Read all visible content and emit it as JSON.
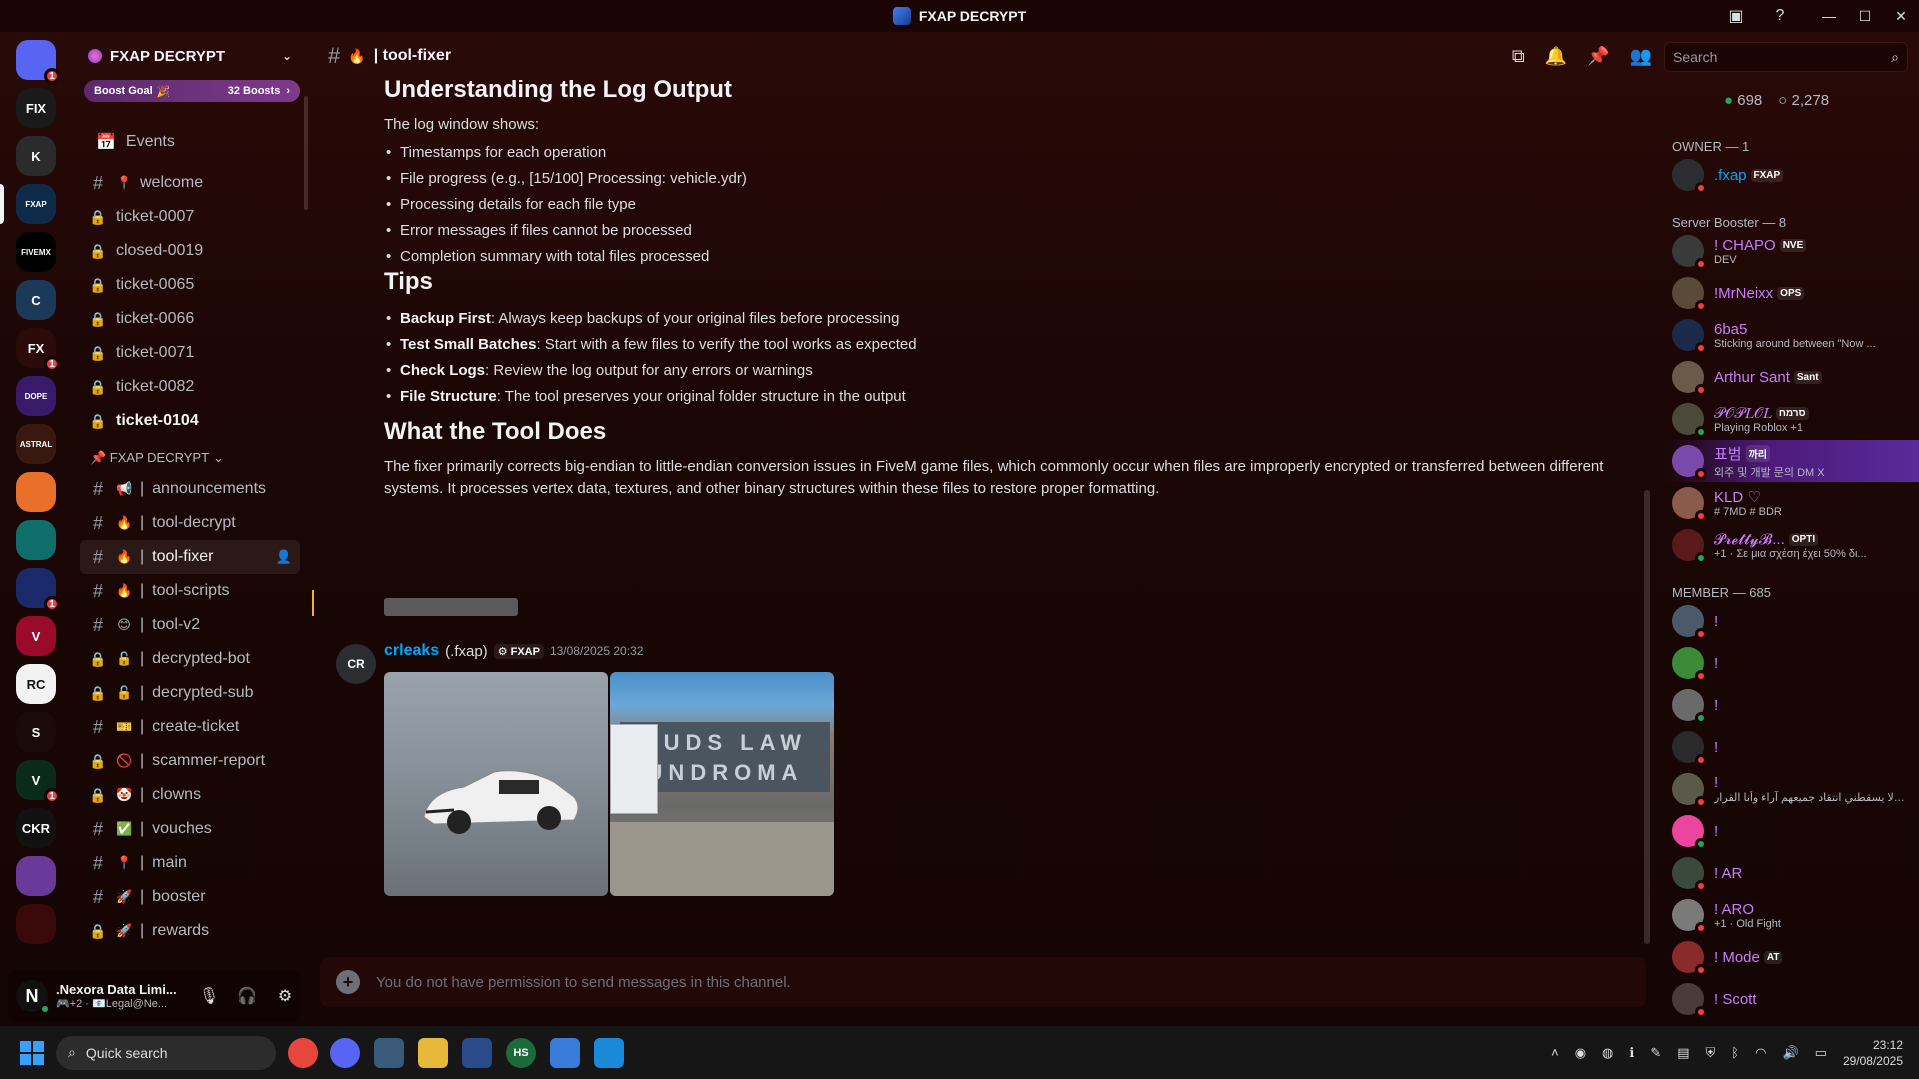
{
  "window": {
    "title": "FXAP DECRYPT"
  },
  "rail": {
    "servers": [
      {
        "name": "dm",
        "color": "#5865f2",
        "label": "",
        "badge": "1"
      },
      {
        "name": "fix-escrow",
        "color": "#1a1a1a",
        "label": "FIX",
        "badge": ""
      },
      {
        "name": "kings",
        "color": "#2b2b2b",
        "label": "K",
        "badge": ""
      },
      {
        "name": "fxap-decrypt",
        "color": "#0f2b4a",
        "label": "FXAP",
        "badge": ""
      },
      {
        "name": "fivemx",
        "color": "#000000",
        "label": "FIVEMX",
        "badge": ""
      },
      {
        "name": "c-server",
        "color": "#1b3a5a",
        "label": "C",
        "badge": ""
      },
      {
        "name": "fx-server",
        "color": "#2b0a0a",
        "label": "FX",
        "badge": "1"
      },
      {
        "name": "dope",
        "color": "#3a1a6a",
        "label": "DOPE",
        "badge": ""
      },
      {
        "name": "astral-leaks",
        "color": "#3a1a10",
        "label": "ASTRAL",
        "badge": ""
      },
      {
        "name": "stripes",
        "color": "#e8702a",
        "label": "",
        "badge": ""
      },
      {
        "name": "clock-server",
        "color": "#0f6e6a",
        "label": "",
        "badge": ""
      },
      {
        "name": "star-server",
        "color": "#1a2a6a",
        "label": "",
        "badge": "1"
      },
      {
        "name": "v-server",
        "color": "#9a0a2a",
        "label": "V",
        "badge": ""
      },
      {
        "name": "rc-server",
        "color": "#f2f2f2",
        "label": "RC",
        "badge": ""
      },
      {
        "name": "s-server",
        "color": "#1a0a0a",
        "label": "S",
        "badge": ""
      },
      {
        "name": "vy-server",
        "color": "#0a2a1a",
        "label": "V",
        "badge": "1"
      },
      {
        "name": "ckr",
        "color": "#111111",
        "label": "CKR",
        "badge": ""
      },
      {
        "name": "pride",
        "color": "#6a3a9a",
        "label": "",
        "badge": ""
      },
      {
        "name": "red-char",
        "color": "#3a0a0a",
        "label": "",
        "badge": ""
      }
    ]
  },
  "sidebar": {
    "guild_name": "FXAP DECRYPT",
    "boost_label": "Boost Goal",
    "boost_count": "32 Boosts",
    "events_label": "Events",
    "channels_top": [
      {
        "icon": "hash",
        "emoji": "📍",
        "label": "welcome",
        "bold": false
      },
      {
        "icon": "lock",
        "emoji": "",
        "label": "ticket-0007",
        "bold": false
      },
      {
        "icon": "lock",
        "emoji": "",
        "label": "closed-0019",
        "bold": false
      },
      {
        "icon": "lock",
        "emoji": "",
        "label": "ticket-0065",
        "bold": false
      },
      {
        "icon": "lock",
        "emoji": "",
        "label": "ticket-0066",
        "bold": false
      },
      {
        "icon": "lock",
        "emoji": "",
        "label": "ticket-0071",
        "bold": false
      },
      {
        "icon": "lock",
        "emoji": "",
        "label": "ticket-0082",
        "bold": false
      },
      {
        "icon": "lock",
        "emoji": "",
        "label": "ticket-0104",
        "bold": true
      }
    ],
    "category": "📌 FXAP DECRYPT",
    "channels": [
      {
        "icon": "hash",
        "emoji": "📢",
        "label": "announcements"
      },
      {
        "icon": "hash",
        "emoji": "🔥",
        "label": "tool-decrypt"
      },
      {
        "icon": "hash",
        "emoji": "🔥",
        "label": "tool-fixer",
        "active": true
      },
      {
        "icon": "hash",
        "emoji": "🔥",
        "label": "tool-scripts"
      },
      {
        "icon": "hash",
        "emoji": "😊",
        "label": "tool-v2"
      },
      {
        "icon": "lock",
        "emoji": "🔓",
        "label": "decrypted-bot"
      },
      {
        "icon": "lock",
        "emoji": "🔓",
        "label": "decrypted-sub"
      },
      {
        "icon": "hash",
        "emoji": "🎫",
        "label": "create-ticket"
      },
      {
        "icon": "lock",
        "emoji": "🚫",
        "label": "scammer-report"
      },
      {
        "icon": "lock",
        "emoji": "🤡",
        "label": "clowns"
      },
      {
        "icon": "hash",
        "emoji": "✅",
        "label": "vouches"
      },
      {
        "icon": "hash",
        "emoji": "📍",
        "label": "main"
      },
      {
        "icon": "hash",
        "emoji": "🚀",
        "label": "booster"
      },
      {
        "icon": "lock",
        "emoji": "🚀",
        "label": "rewards"
      }
    ],
    "separator": "|"
  },
  "user": {
    "name": ".Nexora Data Limi...",
    "status": "🎮+2 · 📧Legal@Ne...",
    "initial": "N"
  },
  "chat": {
    "channel_emoji": "🔥",
    "channel_name": "| tool-fixer",
    "search_placeholder": "Search",
    "log_heading": "Understanding the Log Output",
    "log_intro": "The log window shows:",
    "log_items": [
      "Timestamps for each operation",
      "File progress (e.g., [15/100] Processing: vehicle.ydr)",
      "Processing details for each file type",
      "Error messages if files cannot be processed",
      "Completion summary with total files processed"
    ],
    "tips_heading": "Tips",
    "tips": [
      {
        "b": "Backup First",
        "t": ": Always keep backups of your original files before processing"
      },
      {
        "b": "Test Small Batches",
        "t": ": Start with a few files to verify the tool works as expected"
      },
      {
        "b": "Check Logs",
        "t": ": Review the log output for any errors or warnings"
      },
      {
        "b": "File Structure",
        "t": ": The tool preserves your original folder structure in the output"
      }
    ],
    "does_heading": "What the Tool Does",
    "does_text": "The fixer primarily corrects big-endian to little-endian conversion issues in FiveM game files, which commonly occur when files are improperly encrypted or transferred between different systems. It processes vertex data, textures, and other binary structures within these files to restore proper formatting.",
    "msg_author": "crleaks",
    "msg_handle": "(.fxap)",
    "msg_tag": "FXAP",
    "msg_time": "13/08/2025 20:32",
    "avatar_label": "CR",
    "sign_text": "SUDS LAW\nUNDROMA",
    "composer_text": "You do not have permission to send messages in this channel."
  },
  "members": {
    "online": "698",
    "total": "2,278",
    "owner_heading": "OWNER — 1",
    "owner": {
      "name": ".fxap",
      "tag": "FXAP",
      "color": "#00a8fc"
    },
    "booster_heading": "Server Booster — 8",
    "boosters": [
      {
        "name": "! CHAPO",
        "tag": "NVE",
        "sub": "DEV",
        "color": "#c77dff",
        "av": "#3a3a3a",
        "online": false
      },
      {
        "name": "!MrNeixx",
        "tag": "OPS",
        "sub": "",
        "color": "#c77dff",
        "av": "#5a4a3a",
        "online": false
      },
      {
        "name": "6ba5",
        "tag": "",
        "sub": "Sticking around between \"Now ...",
        "color": "#c77dff",
        "av": "#1a2a4a",
        "online": false
      },
      {
        "name": "Arthur Sant",
        "tag": "Sant",
        "sub": "",
        "color": "#c77dff",
        "av": "#6a5a4a",
        "online": false
      },
      {
        "name": "𝒫𝒪𝒫𝐿𝒪𝐿",
        "tag": "סרמח",
        "sub": "Playing Roblox +1",
        "color": "#c77dff",
        "av": "#4a4a3a",
        "online": true
      },
      {
        "name": "표범",
        "tag": "까리",
        "sub": "외주 및 개발 문의 DM X",
        "color": "#c77dff",
        "av": "#7a4aaa",
        "online": false,
        "highlight": true
      },
      {
        "name": "KLD ♡",
        "tag": "",
        "sub": "# 7MD # BDR",
        "color": "#c77dff",
        "av": "#8a5a4a",
        "online": false
      },
      {
        "name": "𝓟𝓻𝓮𝓽𝓽𝔂𝓑...",
        "tag": "OPTI",
        "sub": "+1 · Σε μια σχέση έχει 50% δι...",
        "color": "#c77dff",
        "av": "#5a1a1a",
        "online": true
      }
    ],
    "member_heading": "MEMBER — 685",
    "members": [
      {
        "name": "!",
        "sub": "",
        "av": "#4a5a6a",
        "online": false
      },
      {
        "name": "!",
        "sub": "",
        "av": "#3a8a3a",
        "online": false
      },
      {
        "name": "!",
        "sub": "",
        "av": "#6a6a6a",
        "online": true
      },
      {
        "name": "!",
        "sub": "",
        "av": "#2a2a2a",
        "online": false
      },
      {
        "name": "!",
        "sub": "مدح ولا يسقطني انتقاد جميعهم آراء وأنا القرار",
        "av": "#5a5a4a",
        "online": false
      },
      {
        "name": "!",
        "sub": "",
        "av": "#eb459e",
        "online": true
      },
      {
        "name": "! AR",
        "sub": "",
        "av": "#3a4a3a",
        "online": false
      },
      {
        "name": "! ARO",
        "sub": "+1 · Old Fight",
        "av": "#7a7a7a",
        "online": false
      },
      {
        "name": "! Mode",
        "sub": "",
        "av": "#8a2a2a",
        "online": false,
        "tag": "AT"
      },
      {
        "name": "! Scott",
        "sub": "",
        "av": "#4a3a3a",
        "online": false
      }
    ]
  },
  "taskbar": {
    "search_label": "Quick search",
    "time": "23:12",
    "date": "29/08/2025"
  }
}
